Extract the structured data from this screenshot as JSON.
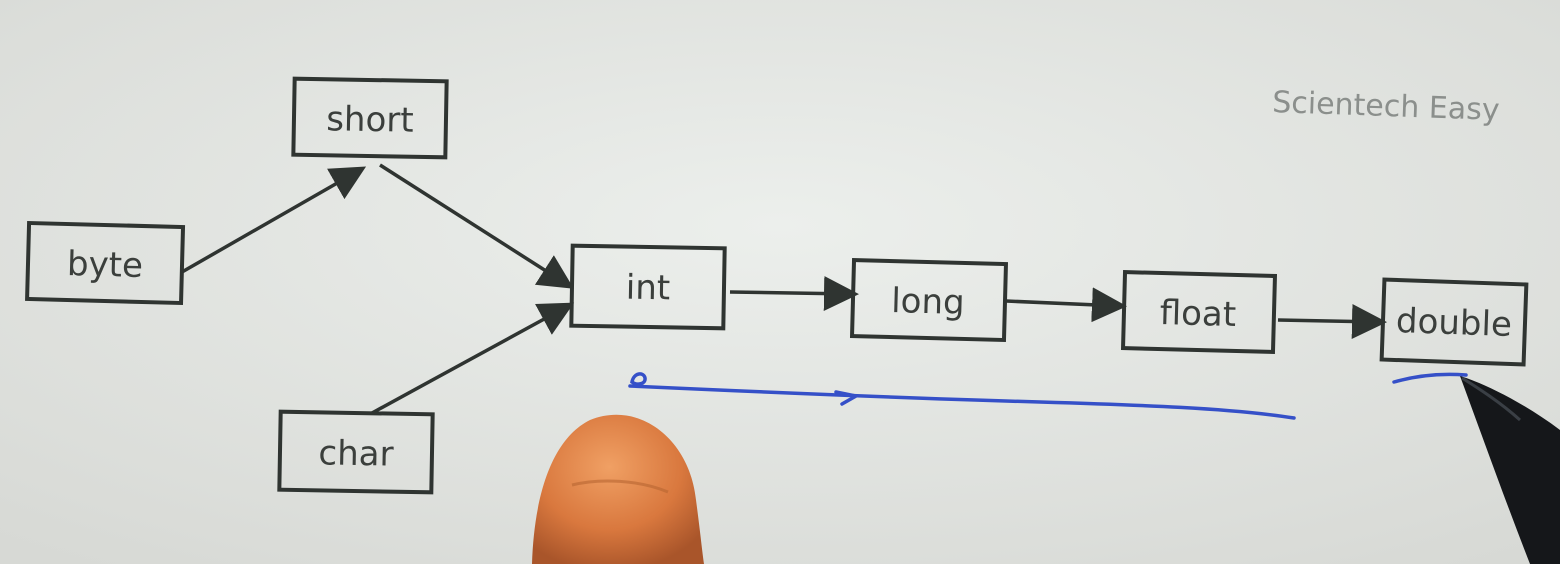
{
  "watermark": "Scientech Easy",
  "nodes": {
    "byte": "byte",
    "short": "short",
    "char": "char",
    "int": "int",
    "long": "long",
    "float": "float",
    "double": "double"
  },
  "colors": {
    "paper": "#e4e6e2",
    "box_border": "#2f3431",
    "arrow": "#2f3431",
    "ink": "#3550c8"
  }
}
